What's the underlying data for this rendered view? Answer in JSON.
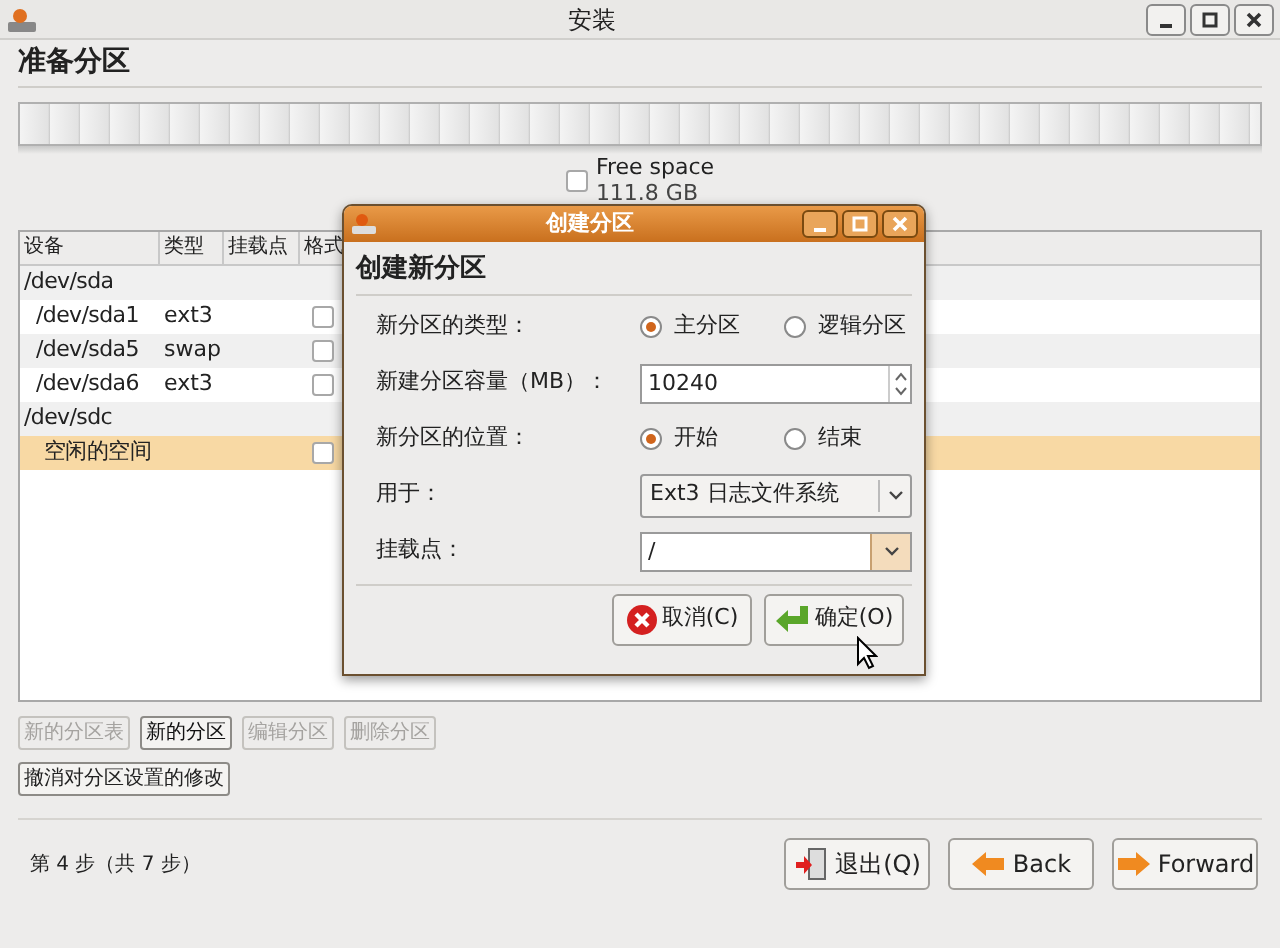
{
  "window": {
    "title": "安装"
  },
  "page_title": "准备分区",
  "legend": {
    "label": "Free space",
    "size": "111.8 GB",
    "checked": false
  },
  "table": {
    "columns": [
      "设备",
      "类型",
      "挂载点",
      "格式"
    ],
    "rows": [
      {
        "device": "/dev/sda",
        "selected": false,
        "children": [
          {
            "device": "/dev/sda1",
            "type": "ext3",
            "format": false,
            "selected": false
          },
          {
            "device": "/dev/sda5",
            "type": "swap",
            "format": false,
            "selected": false
          },
          {
            "device": "/dev/sda6",
            "type": "ext3",
            "format": false,
            "selected": false
          }
        ]
      },
      {
        "device": "/dev/sdc",
        "selected": false,
        "children": [
          {
            "device": "空闲的空间",
            "format": false,
            "selected": true
          }
        ]
      }
    ]
  },
  "partition_buttons": [
    {
      "label": "新的分区表",
      "disabled": true
    },
    {
      "label": "新的分区",
      "disabled": false
    },
    {
      "label": "编辑分区",
      "disabled": true
    },
    {
      "label": "删除分区",
      "disabled": true
    }
  ],
  "revert_button": "撤消对分区设置的修改",
  "step": "第 4 步（共 7 步）",
  "nav_buttons": [
    {
      "label": "退出(Q)",
      "kind": "quit"
    },
    {
      "label": "Back",
      "kind": "back"
    },
    {
      "label": "Forward",
      "kind": "forward"
    }
  ],
  "dialog": {
    "title": "创建分区",
    "heading": "创建新分区",
    "fields": [
      {
        "kind": "radio",
        "label": "新分区的类型：",
        "options": [
          {
            "label": "主分区",
            "selected": true
          },
          {
            "label": "逻辑分区",
            "selected": false
          }
        ]
      },
      {
        "kind": "spin",
        "label": "新建分区容量（MB）：",
        "value": "10240"
      },
      {
        "kind": "radio",
        "label": "新分区的位置：",
        "options": [
          {
            "label": "开始",
            "selected": true
          },
          {
            "label": "结束",
            "selected": false
          }
        ]
      },
      {
        "kind": "combo",
        "label": "用于：",
        "value": "Ext3 日志文件系统"
      },
      {
        "kind": "combo_entry",
        "label": "挂载点：",
        "value": "/"
      }
    ],
    "buttons": [
      {
        "label": "取消(C)",
        "kind": "cancel"
      },
      {
        "label": "确定(O)",
        "kind": "ok"
      }
    ]
  }
}
